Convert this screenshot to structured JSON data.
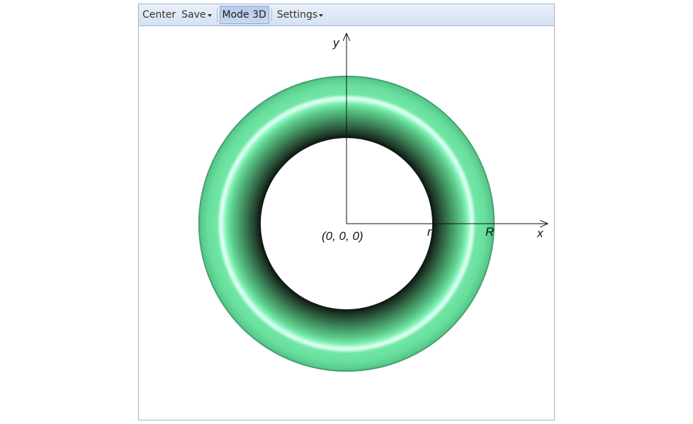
{
  "toolbar": {
    "center_label": "Center",
    "save_label": "Save",
    "mode3d_label": "Mode 3D",
    "settings_label": "Settings"
  },
  "diagram": {
    "axis_y_label": "y",
    "axis_x_label": "x",
    "origin_label": "(0, 0, 0)",
    "inner_radius_label": "r",
    "outer_radius_label": "R"
  },
  "colors": {
    "torus_light": "#7ff0b4",
    "torus_mid": "#5fd896",
    "torus_dark": "#1b2e22",
    "highlight": "#d8fff4",
    "toolbar_border": "#9fb4d3"
  }
}
